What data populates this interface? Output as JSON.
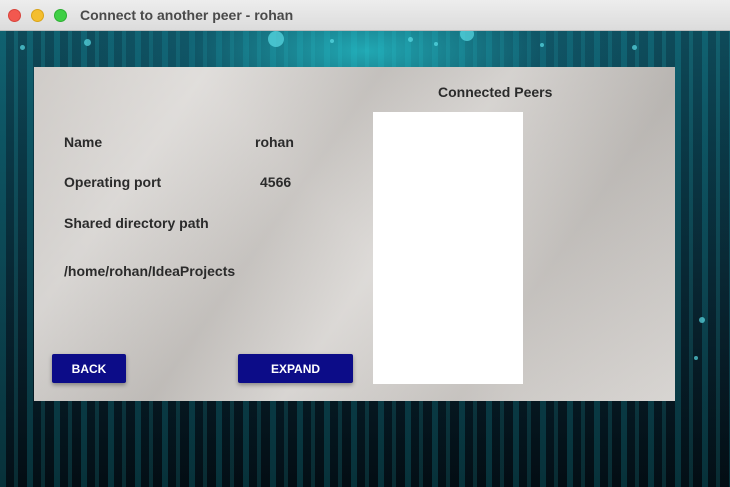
{
  "window": {
    "title": "Connect to another peer - rohan"
  },
  "form": {
    "name_label": "Name",
    "name_value": "rohan",
    "port_label": "Operating port",
    "port_value": "4566",
    "shared_dir_label": "Shared directory path",
    "shared_dir_value": "/home/rohan/IdeaProjects"
  },
  "buttons": {
    "back": "BACK",
    "expand": "EXPAND"
  },
  "peers": {
    "heading": "Connected Peers",
    "items": []
  },
  "colors": {
    "button_bg": "#0c0c88",
    "button_text": "#ffffff",
    "label_text": "#2b2b2b"
  }
}
